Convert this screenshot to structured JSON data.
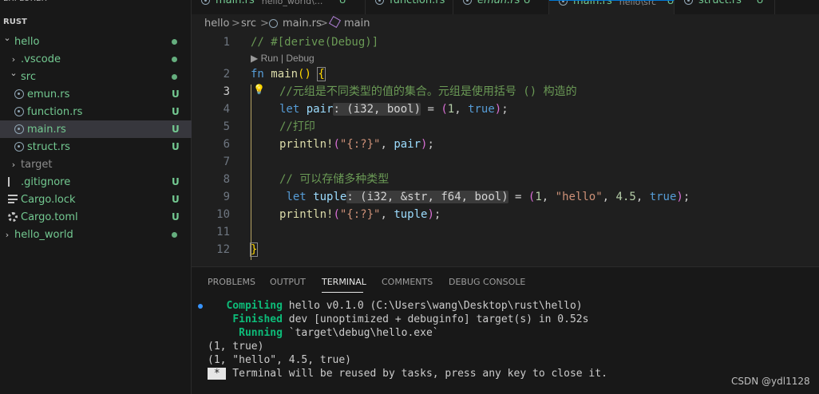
{
  "explorer": {
    "title": "EXPLORER",
    "section": "RUST",
    "tree": [
      {
        "label": "hello",
        "chevron": "down",
        "status": "dot",
        "color": "#73c991"
      },
      {
        "label": ".vscode",
        "chevron": "right",
        "status": "dot",
        "color": "#73c991"
      },
      {
        "label": "src",
        "chevron": "down",
        "status": "dot",
        "color": "#73c991"
      },
      {
        "label": "emun.rs",
        "icon": "rust-file-icon",
        "status": "U",
        "color": "#73c991"
      },
      {
        "label": "function.rs",
        "icon": "rust-file-icon",
        "status": "U",
        "color": "#73c991"
      },
      {
        "label": "main.rs",
        "icon": "rust-file-icon",
        "status": "U",
        "color": "#73c991",
        "selected": true
      },
      {
        "label": "struct.rs",
        "icon": "rust-file-icon",
        "status": "U",
        "color": "#73c991"
      },
      {
        "label": "target",
        "chevron": "right",
        "status": "",
        "color": "#8c8c8c"
      },
      {
        "label": ".gitignore",
        "status": "U",
        "color": "#73c991"
      },
      {
        "label": "Cargo.lock",
        "icon": "lines-file-icon",
        "status": "U",
        "color": "#73c991"
      },
      {
        "label": "Cargo.toml",
        "icon": "gear-file-icon",
        "status": "U",
        "color": "#73c991"
      },
      {
        "label": "hello_world",
        "chevron": "right",
        "status": "dot",
        "color": "#73c991"
      }
    ]
  },
  "tabs": [
    {
      "name": "main.rs",
      "path": "hello_world\\...",
      "status": "U",
      "name_color": "#73c991",
      "italic": false
    },
    {
      "name": "function.rs",
      "path": "",
      "status": "U",
      "name_color": "#73c991",
      "italic": false
    },
    {
      "name": "emun.rs",
      "path": "",
      "status": "U",
      "name_color": "#73c991",
      "italic": true
    },
    {
      "name": "main.rs",
      "path": "hello\\src",
      "status": "U",
      "name_color": "#73c991",
      "italic": false,
      "active": true
    },
    {
      "name": "struct.rs",
      "path": "",
      "status": "U",
      "name_color": "#73c991",
      "italic": false
    }
  ],
  "breadcrumb": {
    "p1": "hello",
    "p2": "src",
    "file": "main.rs",
    "symbol": "main",
    "sep": ">"
  },
  "editor": {
    "line_numbers": [
      "1",
      "2",
      "3",
      "4",
      "5",
      "6",
      "7",
      "8",
      "9",
      "10",
      "11",
      "12"
    ],
    "codelens": "▶ Run | Debug",
    "current_line": 3
  },
  "panel": {
    "tabs": [
      "PROBLEMS",
      "OUTPUT",
      "TERMINAL",
      "COMMENTS",
      "DEBUG CONSOLE"
    ],
    "active_tab": "TERMINAL",
    "terminal": {
      "l1_kw": "Compiling",
      "l1_rest": " hello v0.1.0 (C:\\Users\\wang\\Desktop\\rust\\hello)",
      "l2_kw": "Finished",
      "l2_rest": " dev [unoptimized + debuginfo] target(s) in 0.52s",
      "l3_kw": "Running",
      "l3_rest": " `target\\debug\\hello.exe`",
      "l4": "(1, true)",
      "l5": "(1, \"hello\", 4.5, true)",
      "l6_star": " * ",
      "l6_rest": " Terminal will be reused by tasks, press any key to close it."
    }
  },
  "watermark": "CSDN @ydl1128"
}
